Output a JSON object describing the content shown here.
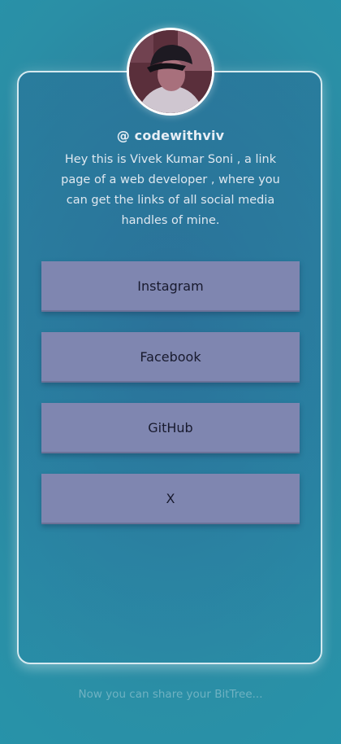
{
  "profile": {
    "handle": "@ codewithviv",
    "bio": "Hey this is Vivek Kumar Soni , a link page of a web developer , where you can get the links of all social media handles of mine.",
    "avatar_icon": "user-avatar-photo"
  },
  "links": [
    {
      "label": "Instagram"
    },
    {
      "label": "Facebook"
    },
    {
      "label": "GitHub"
    },
    {
      "label": "X"
    }
  ],
  "footer": {
    "text": "Now you can share your BitTree..."
  },
  "colors": {
    "background": "#2398ad",
    "card_border": "#d6eaf0",
    "button_bg": "#7f86b0",
    "button_text": "#181a2e",
    "footer_text": "#6fb2c2"
  }
}
